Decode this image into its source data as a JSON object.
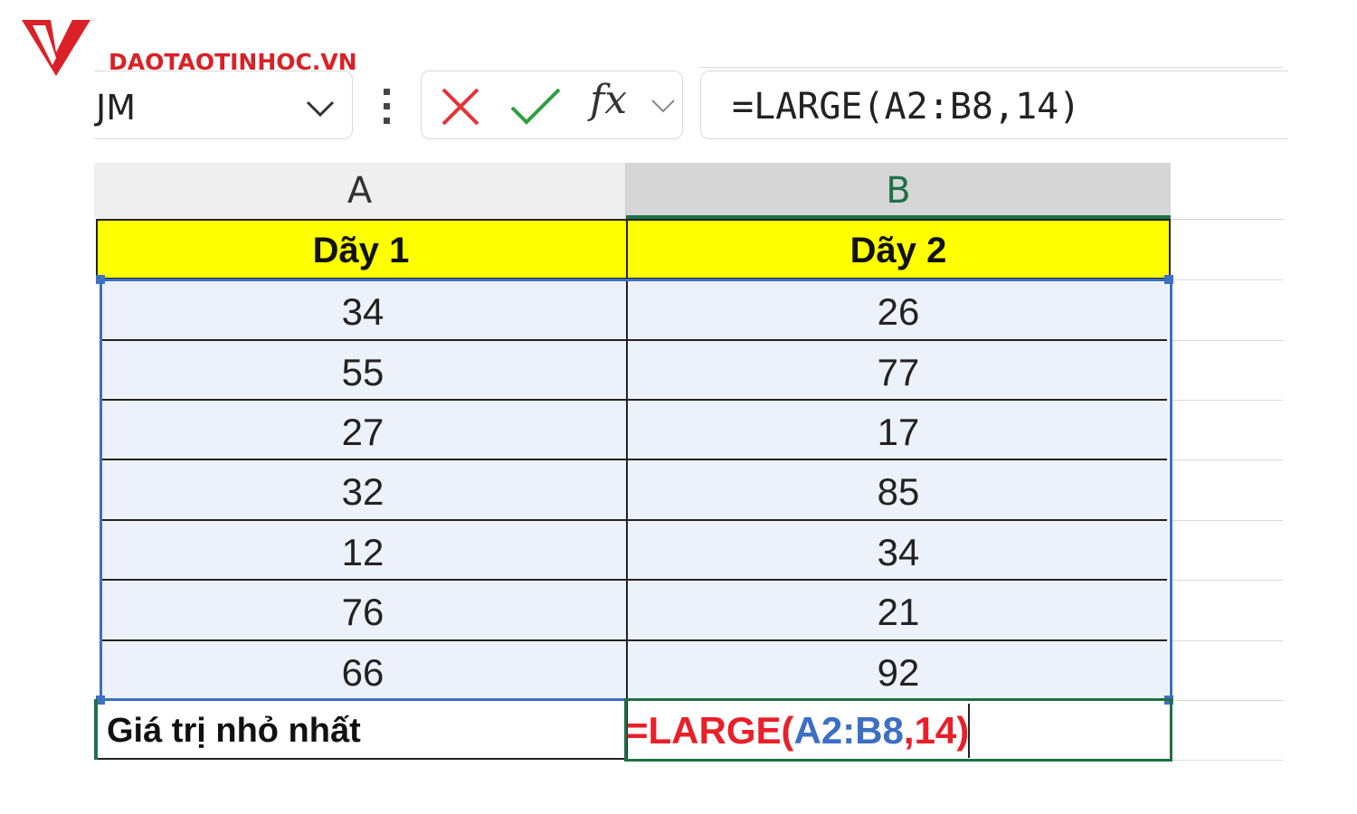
{
  "logo": {
    "text": "DAOTAOTINHOC.VN",
    "brand_color": "#d92127"
  },
  "formula_bar": {
    "name_box_value": "JM",
    "cancel_icon": "cancel-x-icon",
    "enter_icon": "enter-check-icon",
    "fx_label": "fx",
    "formula": "=LARGE(A2:B8,14)"
  },
  "columns": [
    "A",
    "B"
  ],
  "table": {
    "headers": [
      "Dãy 1",
      "Dãy 2"
    ],
    "rows": [
      [
        "34",
        "26"
      ],
      [
        "55",
        "77"
      ],
      [
        "27",
        "17"
      ],
      [
        "32",
        "85"
      ],
      [
        "12",
        "34"
      ],
      [
        "76",
        "21"
      ],
      [
        "66",
        "92"
      ]
    ],
    "result_label": "Giá trị nhỏ nhất",
    "edit_formula": {
      "func": "=LARGE(",
      "range": "A2:B8",
      "comma": ",",
      "arg": "14)"
    }
  },
  "colors": {
    "header_fill": "#ffff00",
    "range_highlight": "#3d6fc4",
    "active_cell": "#1e7145",
    "formula_red": "#e8202a"
  }
}
